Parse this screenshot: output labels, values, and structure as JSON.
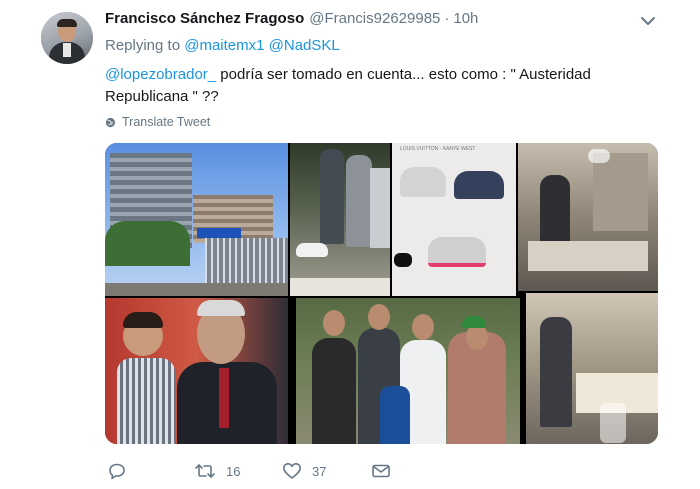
{
  "tweet": {
    "display_name": "Francisco Sánchez Fragoso",
    "handle": "@Francis92629985",
    "separator": "·",
    "time": "10h",
    "replying_prefix": "Replying to",
    "replying_to": [
      "@maitemx1",
      "@NadSKL"
    ],
    "mention": "@lopezobrador_",
    "text_line1": " podría ser tomado en cuenta... esto como : \" Austeridad",
    "text_line2": "Republicana \" ??",
    "translate_label": "Translate Tweet",
    "media": {
      "catalog_label": "LOUIS VUITTON - KANYE WEST"
    }
  },
  "actions": {
    "reply_count": "",
    "retweet_count": "16",
    "like_count": "37"
  },
  "colors": {
    "link": "#1b95e0",
    "muted": "#657786",
    "text": "#14171a"
  }
}
